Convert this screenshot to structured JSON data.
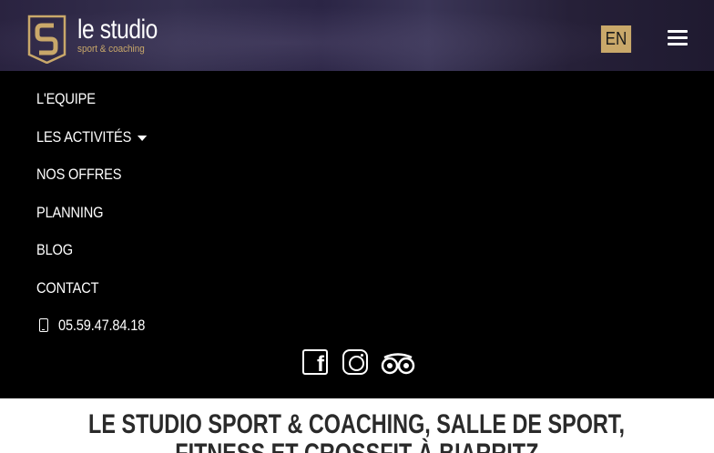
{
  "header": {
    "logo": {
      "main": "le studio",
      "sub": "sport & coaching"
    },
    "lang_button": "EN",
    "menu_icon": "hamburger-menu-icon"
  },
  "nav": {
    "items": [
      {
        "label": "L'EQUIPE"
      },
      {
        "label": "LES ACTIVITÉS",
        "has_dropdown": true
      },
      {
        "label": "NOS OFFRES"
      },
      {
        "label": "PLANNING"
      },
      {
        "label": "BLOG"
      },
      {
        "label": "CONTACT"
      }
    ],
    "phone": "05.59.47.84.18"
  },
  "social": {
    "icons": [
      "facebook-icon",
      "instagram-icon",
      "tripadvisor-icon"
    ]
  },
  "page_title": {
    "line1": "LE STUDIO SPORT & COACHING, SALLE DE SPORT,",
    "line2": "FITNESS ET CROSSFIT À BIARRITZ"
  },
  "colors": {
    "accent": "#c9a86a",
    "background": "#000000",
    "title_band": "#ffffff"
  }
}
